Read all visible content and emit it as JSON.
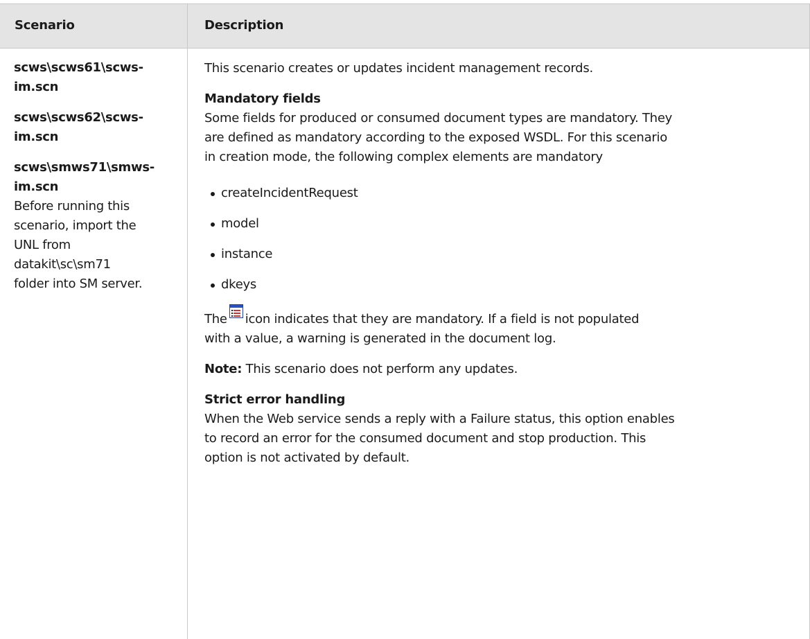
{
  "table": {
    "headers": {
      "scenario": "Scenario",
      "description": "Description"
    },
    "scenario_cell": {
      "paths": [
        "scws\\scws61\\scws-",
        "im.scn",
        "scws\\scws62\\scws-",
        "im.scn",
        "scws\\smws71\\smws-",
        "im.scn"
      ],
      "note_lines": [
        "Before running this",
        "scenario, import the",
        "UNL from",
        "datakit\\sc\\sm71",
        "folder into SM server."
      ]
    },
    "description_cell": {
      "intro": "This scenario creates or updates incident management records.",
      "mandatory_heading": "Mandatory fields",
      "mandatory_lines": [
        "Some fields for produced or consumed document types are mandatory. They",
        "are defined as mandatory according to the exposed WSDL. For this scenario",
        "in creation mode, the following complex elements are mandatory"
      ],
      "bullets": [
        "createIncidentRequest",
        "model",
        "instance",
        "dkeys"
      ],
      "icon_sentence_before": "The",
      "icon_name": "mandatory-field-icon",
      "icon_sentence_after": "icon indicates that they are mandatory. If a field is not populated",
      "icon_sentence_line2": "with a value, a warning is generated in the document log.",
      "note_label": "Note:",
      "note_text": " This scenario does not perform any updates.",
      "strict_heading": "Strict error handling",
      "strict_lines": [
        "When the Web service sends a reply with a Failure status, this option enables",
        "to record an error for the consumed document and stop production. This",
        "option is not activated by default."
      ]
    }
  }
}
